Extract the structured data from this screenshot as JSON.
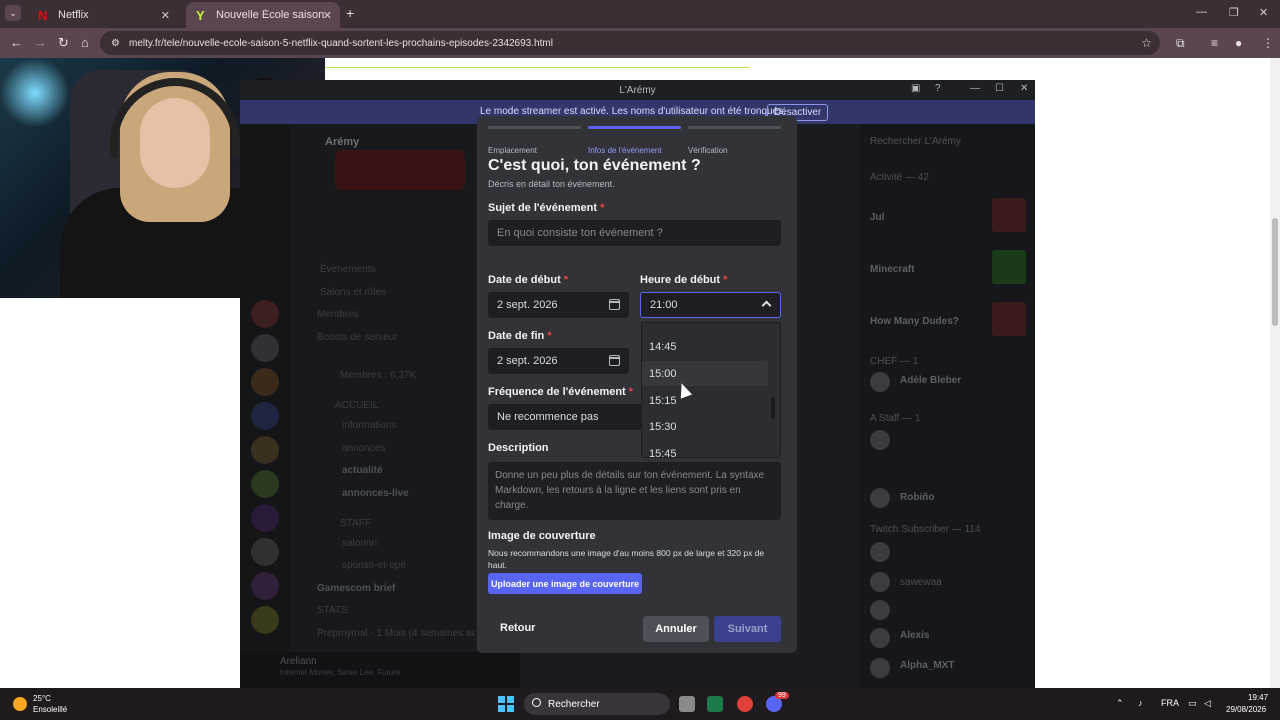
{
  "browser": {
    "tabs": [
      {
        "label": "Netflix",
        "favicon": "N"
      },
      {
        "label": "Nouvelle École saison 5 (Netflix",
        "favicon": "Y"
      }
    ],
    "url": "melty.fr/tele/nouvelle-ecole-saison-5-netflix-quand-sortent-les-prochains-episodes-2342693.html"
  },
  "discord": {
    "window_title": "L'Arémy",
    "streamer_banner": "Le mode streamer est activé. Les noms d'utilisateur ont été tronqués.",
    "streamer_button": "Désactiver",
    "server_name": "Arémy",
    "channels": [
      "Évènements",
      "Salons et rôles",
      "Membres",
      "Boosts de serveur",
      "Membres : 6,37K",
      "ACCUEIL",
      "informations",
      "annonces",
      "actualité",
      "annonces-live",
      "STAFF",
      "salonnn",
      "sponso-et-opé",
      "Gamescom brief",
      "STATS",
      "Prepmymal - 1 Mois (4 semaines actif"
    ],
    "search_placeholder": "Rechercher L'Arémy",
    "members": [
      {
        "name": "Activité — 42"
      },
      {
        "name": "Jul"
      },
      {
        "name": "Minecraft"
      },
      {
        "name": "How Many Dudes?"
      },
      {
        "name": "CHEF — 1"
      },
      {
        "name": "Adèle Bleber"
      },
      {
        "name": "A Staff — 1"
      },
      {
        "name": "Robiño"
      },
      {
        "name": "Twitch Subscriber — 114"
      },
      {
        "name": "sawewaa"
      },
      {
        "name": "Alexis"
      },
      {
        "name": "Alpha_MXT"
      }
    ],
    "user": "Areliann",
    "user_status": "Internet Money, Swae Lee, Future"
  },
  "modal": {
    "steps": [
      "Emplacement",
      "Infos de l'événement",
      "Vérification"
    ],
    "active_step": 1,
    "title": "C'est quoi, ton événement ?",
    "subtitle": "Décris en détail ton événement.",
    "subject_label": "Sujet de l'événement",
    "subject_placeholder": "En quoi consiste ton événement ?",
    "start_date_label": "Date de début",
    "start_date_value": "2 sept. 2026",
    "start_time_label": "Heure de début",
    "start_time_value": "21:00",
    "end_date_label": "Date de fin",
    "end_date_value": "2 sept. 2026",
    "frequency_label": "Fréquence de l'événement",
    "frequency_value": "Ne recommence pas",
    "time_options": [
      "14:45",
      "15:00",
      "15:15",
      "15:30",
      "15:45"
    ],
    "hovered_option": "15:00",
    "description_label": "Description",
    "description_placeholder": "Donne un peu plus de détails sur ton événement. La syntaxe Markdown, les retours à la ligne et les liens sont pris en charge.",
    "cover_title": "Image de couverture",
    "cover_subtitle": "Nous recommandons une image d'au moins 800 px de large et 320 px de haut.",
    "upload_button": "Uploader une image de couverture",
    "back_button": "Retour",
    "cancel_button": "Annuler",
    "next_button": "Suivant",
    "required_mark": "*"
  },
  "taskbar": {
    "weather_temp": "25°C",
    "weather_desc": "Ensoleillé",
    "search_label": "Rechercher",
    "language": "FRA",
    "time": "19:47",
    "date": "29/08/2026",
    "discord_badge": "99"
  },
  "colors": {
    "accent": "#5865f2",
    "modal_bg": "#313338",
    "required": "#f23f42"
  }
}
